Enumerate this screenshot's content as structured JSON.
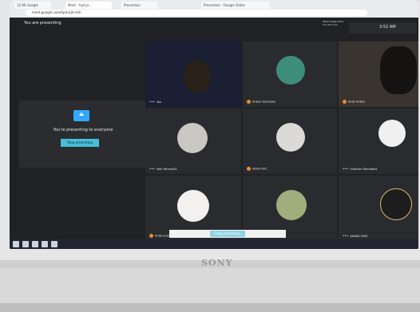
{
  "browser": {
    "tabs": [
      "12:06 Google",
      "Meet - hpd-jz...",
      "Presentasi",
      "Presentasi - Google Slides"
    ],
    "url": "meet.google.com/hpd-jzjm-toh"
  },
  "meet": {
    "presenting_label": "You are presenting",
    "top_right_label": "DEWI ZANJU NUR and 46 more",
    "clock": "3:52 AM",
    "presenting_box": {
      "title": "You're presenting to everyone",
      "stop_button": "Stop presenting"
    },
    "participants": [
      {
        "name": "You",
        "muted": false,
        "icon": "more-dots-icon"
      },
      {
        "name": "Anwar Sasrawan",
        "muted": true,
        "icon": "mic-off-icon"
      },
      {
        "name": "Andy Ardian",
        "muted": true,
        "icon": "mic-off-icon"
      },
      {
        "name": "Moh Fahriza25",
        "muted": false,
        "icon": "more-dots-icon"
      },
      {
        "name": "Abdul Aziz",
        "muted": true,
        "icon": "mic-off-icon"
      },
      {
        "name": "Octavian Ramadani",
        "muted": false,
        "icon": "more-dots-icon"
      },
      {
        "name": "Anita anSoi",
        "muted": true,
        "icon": "mic-off-icon"
      },
      {
        "name": "",
        "muted": false,
        "icon": "none"
      },
      {
        "name": "ANANG FAIZI",
        "muted": false,
        "icon": "more-dots-icon"
      }
    ],
    "bottom_button": "Stop presenting"
  },
  "device": {
    "brand": "SONY"
  },
  "colors": {
    "meet_bg": "#202124",
    "accent": "#34a8ff",
    "mute_dot": "#ea8a3a"
  }
}
